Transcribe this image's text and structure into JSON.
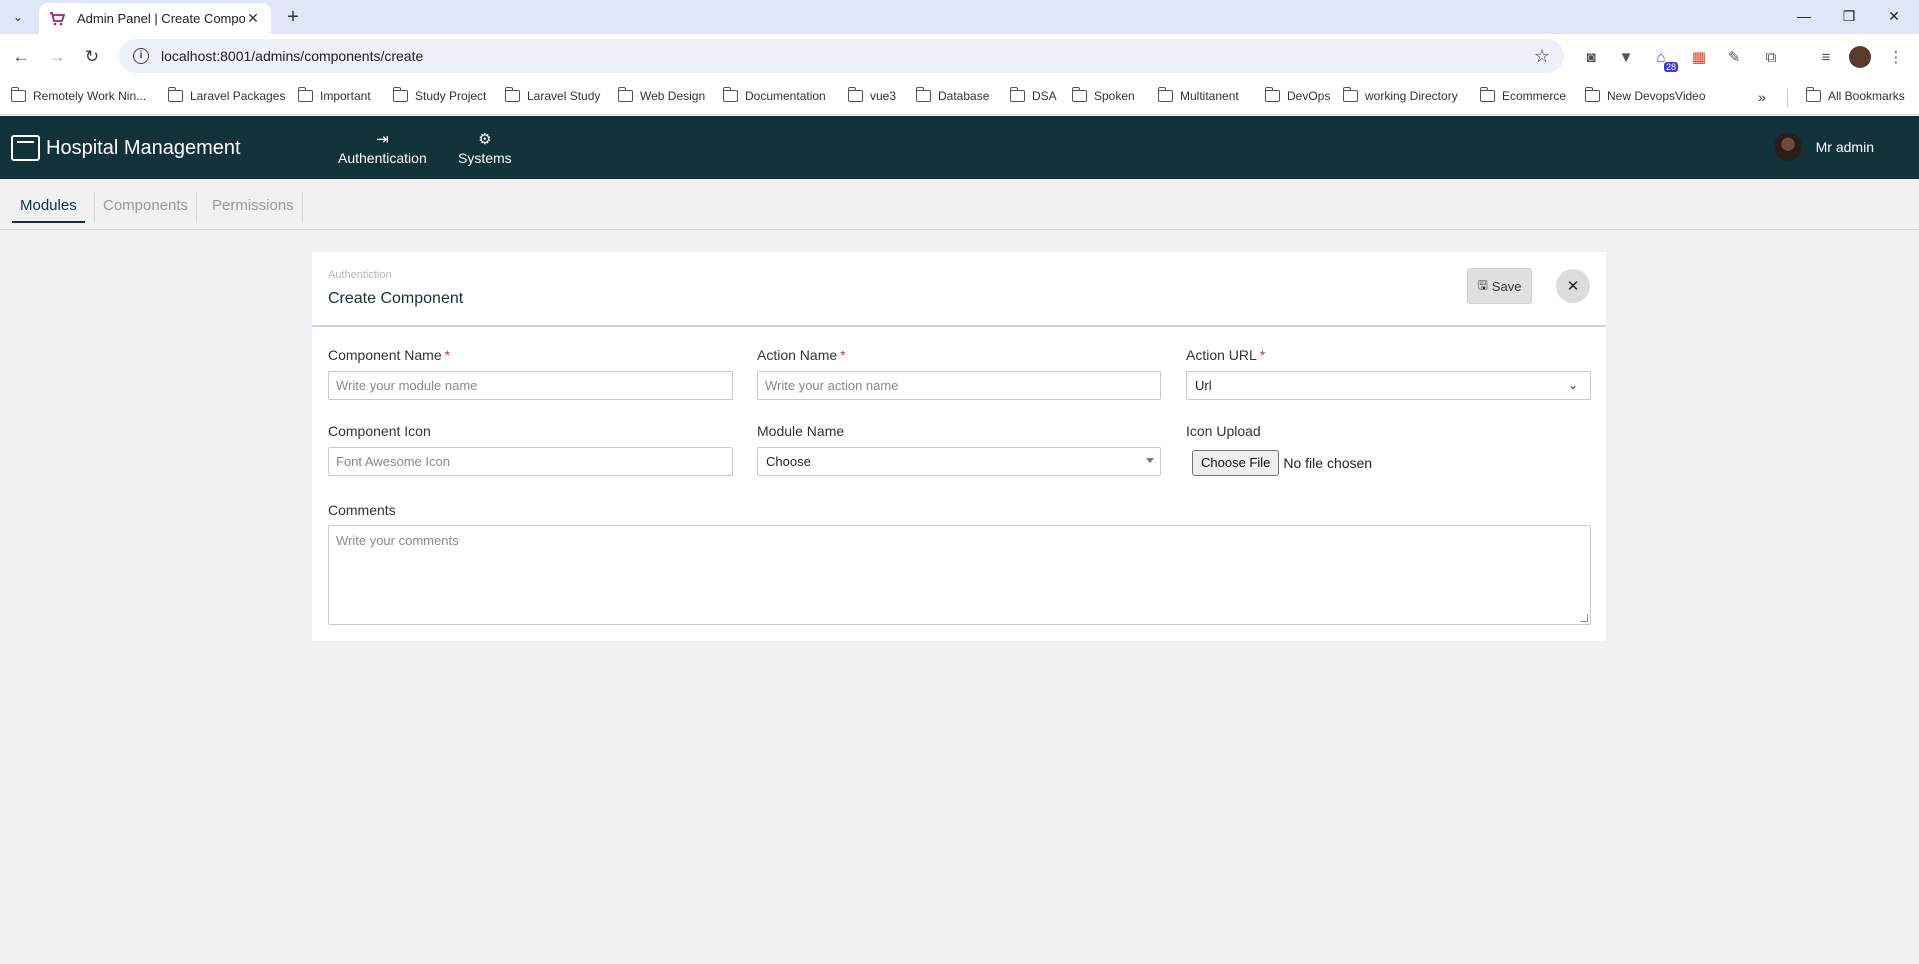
{
  "browser": {
    "tab_title": "Admin Panel | Create Compone",
    "url": "localhost:8001/admins/components/create",
    "extension_badge": "28",
    "bookmarks": [
      "Remotely Work Nin...",
      "Laravel Packages",
      "Important",
      "Study Project",
      "Laravel Study",
      "Web Design",
      "Documentation",
      "vue3",
      "Database",
      "DSA",
      "Spoken",
      "Multitanent",
      "DevOps",
      "working Directory",
      "Ecommerce",
      "New DevopsVideo"
    ],
    "all_bookmarks": "All Bookmarks",
    "more_bookmarks": "»"
  },
  "header": {
    "app_name": "Hospital Management",
    "nav": [
      {
        "label": "Authentication",
        "icon": "sign-out-icon"
      },
      {
        "label": "Systems",
        "icon": "users-cog-icon"
      }
    ],
    "user_name": "Mr admin"
  },
  "subtabs": [
    {
      "label": "Modules",
      "active": true
    },
    {
      "label": "Components",
      "active": false
    },
    {
      "label": "Permissions",
      "active": false
    }
  ],
  "form": {
    "breadcrumb": "Authentiction",
    "title": "Create Component",
    "save_label": "Save",
    "component_name": {
      "label": "Component Name",
      "placeholder": "Write your module name",
      "value": ""
    },
    "action_name": {
      "label": "Action Name",
      "placeholder": "Write your action name",
      "value": ""
    },
    "action_url": {
      "label": "Action URL",
      "selected": "Url"
    },
    "component_icon": {
      "label": "Component Icon",
      "placeholder": "Font Awesome Icon",
      "value": ""
    },
    "module_name": {
      "label": "Module Name",
      "selected": "Choose"
    },
    "icon_upload": {
      "label": "Icon Upload",
      "button": "Choose File",
      "status": "No file chosen"
    },
    "comments": {
      "label": "Comments",
      "placeholder": "Write your comments",
      "value": ""
    },
    "required_mark": "*"
  },
  "colors": {
    "header_bg": "#12323b",
    "page_bg": "#f1f1f1",
    "required": "#dc3545"
  }
}
